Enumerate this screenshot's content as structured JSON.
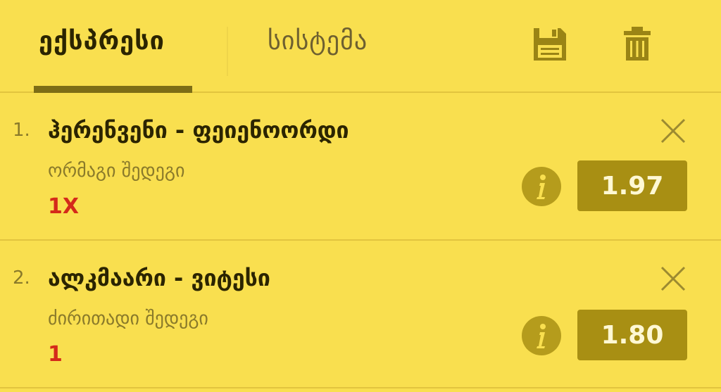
{
  "tabs": {
    "express_label": "ექსპრესი",
    "system_label": "სისტემა"
  },
  "toolbar": {
    "save_icon": "floppy-disk-icon",
    "trash_icon": "trash-icon"
  },
  "bets": [
    {
      "number": "1.",
      "title": "ჰერენვენი - ფეიენოორდი",
      "market": "ორმაგი შედეგი",
      "pick": "1X",
      "odds": "1.97"
    },
    {
      "number": "2.",
      "title": "ალკმაარი - ვიტესი",
      "market": "ძირითადი შედეგი",
      "pick": "1",
      "odds": "1.80"
    }
  ],
  "colors": {
    "background": "#f9df4f",
    "accent": "#a88f13",
    "pick": "#d42a1a"
  }
}
